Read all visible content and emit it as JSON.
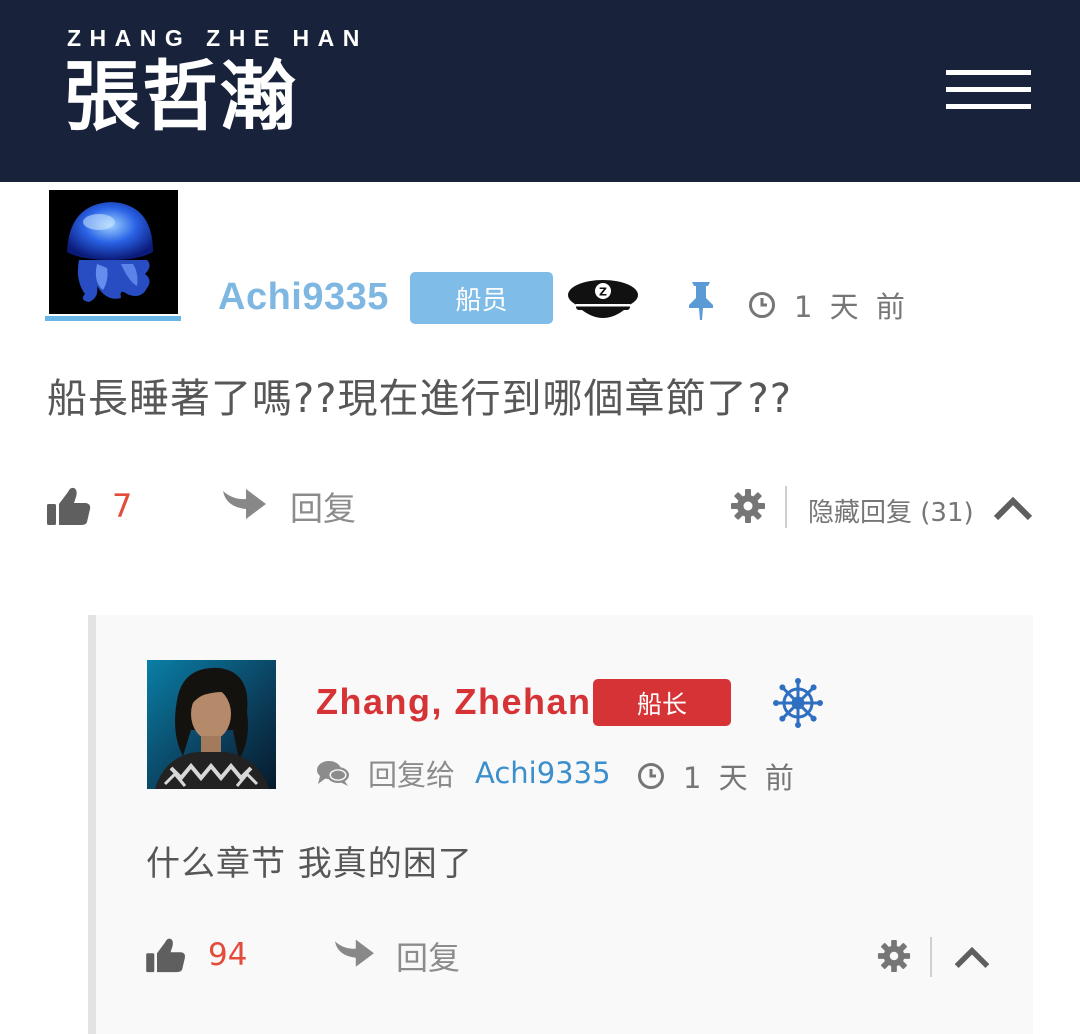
{
  "header": {
    "logo_latin": "ZHANG ZHE HAN",
    "logo_cjk": "張哲瀚",
    "menu_icon": "hamburger-menu-icon"
  },
  "comment": {
    "author": "Achi9335",
    "badge": "船员",
    "badge_color": "#7fbce8",
    "time": "1 天 前",
    "text": "船長睡著了嗎??現在進行到哪個章節了??",
    "likes": "7",
    "reply_label": "回复",
    "hide_replies_label": "隐藏回复 (31)"
  },
  "reply": {
    "author": "Zhang, Zhehan",
    "badge": "船长",
    "badge_color": "#d63337",
    "reply_to_label": "回复给",
    "reply_to_user": "Achi9335",
    "time": "1 天 前",
    "text": "什么章节 我真的困了",
    "likes": "94",
    "reply_label": "回复"
  },
  "colors": {
    "header_bg": "#18233b",
    "like_count": "#e34b3a",
    "link_blue": "#3a8fcc"
  }
}
